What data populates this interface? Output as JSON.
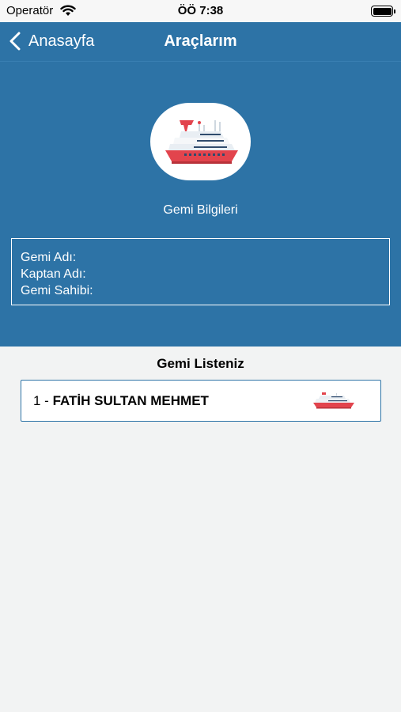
{
  "status_bar": {
    "carrier": "Operatör",
    "time": "ÖÖ 7:38"
  },
  "nav": {
    "back_label": "Anasayfa",
    "title": "Araçlarım"
  },
  "ship_info": {
    "section_label": "Gemi Bilgileri",
    "fields": [
      "Gemi Adı:",
      "Kaptan Adı:",
      "Gemi Sahibi:"
    ]
  },
  "ship_list": {
    "title": "Gemi Listeniz",
    "items": [
      {
        "index": "1 - ",
        "name": "FATİH SULTAN MEHMET",
        "icon": "ship-icon"
      }
    ]
  },
  "colors": {
    "header_bg": "#2d73a6",
    "body_bg": "#f2f3f3",
    "ship_red": "#e2444d",
    "ship_navy": "#2f4b6d"
  }
}
